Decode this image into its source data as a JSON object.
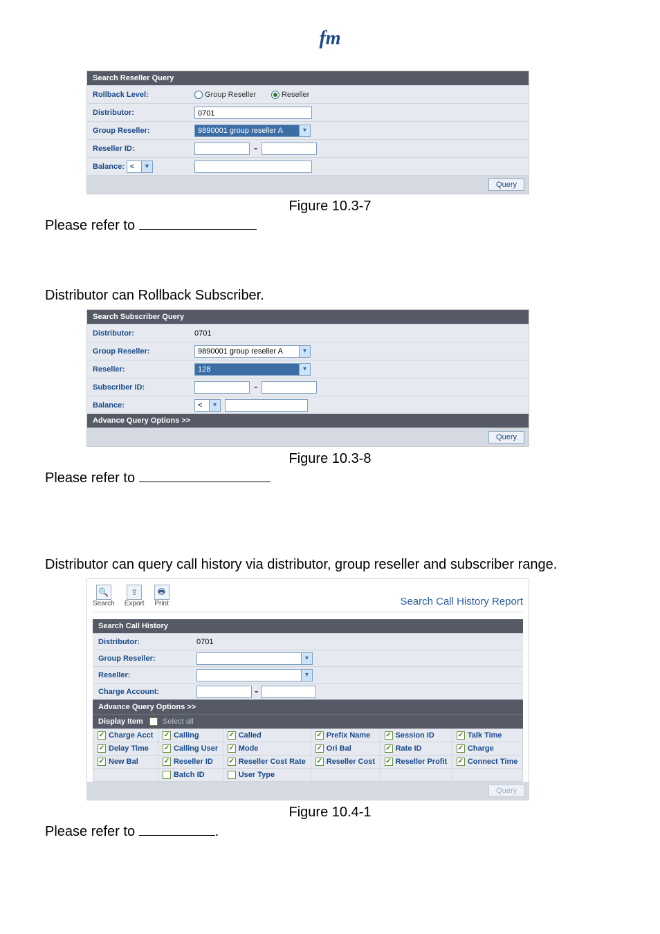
{
  "logo": "fm",
  "panel1": {
    "header": "Search Reseller Query",
    "rows": {
      "rollback_label": "Rollback Level:",
      "radio_group": "Group Reseller",
      "radio_reseller": "Reseller",
      "distributor_label": "Distributor:",
      "distributor_value": "0701",
      "group_reseller_label": "Group Reseller:",
      "group_reseller_value": "9890001 group reseller A",
      "reseller_id_label": "Reseller ID:",
      "reseller_id_sep": "-",
      "balance_label": "Balance:",
      "balance_op": "<"
    },
    "query_btn": "Query",
    "caption": "Figure 10.3-7"
  },
  "refer1": "Please refer to ",
  "section2_intro": "Distributor can Rollback Subscriber.",
  "panel2": {
    "header": "Search Subscriber Query",
    "rows": {
      "distributor_label": "Distributor:",
      "distributor_value": "0701",
      "group_reseller_label": "Group Reseller:",
      "group_reseller_value": "9890001 group reseller A",
      "reseller_label": "Reseller:",
      "reseller_value": "128",
      "subscriber_id_label": "Subscriber ID:",
      "subscriber_id_sep": "-",
      "balance_label": "Balance:",
      "balance_op": "<"
    },
    "adv": "Advance Query Options >>",
    "query_btn": "Query",
    "caption": "Figure 10.3-8"
  },
  "refer2": "Please refer to ",
  "section3_intro": "Distributor can query call history via distributor, group reseller and subscriber range.",
  "report": {
    "toolbar": {
      "search": "Search",
      "export": "Export",
      "print": "Print"
    },
    "title": "Search Call History Report",
    "header": "Search Call History",
    "rows": {
      "distributor_label": "Distributor:",
      "distributor_value": "0701",
      "group_reseller_label": "Group Reseller:",
      "reseller_label": "Reseller:",
      "charge_account_label": "Charge Account:",
      "charge_account_sep": "-"
    },
    "adv": "Advance Query Options >>",
    "display_item": "Display Item",
    "select_all": "Select all",
    "cols": {
      "charge_acct": "Charge Acct",
      "calling": "Calling",
      "called": "Called",
      "prefix_name": "Prefix Name",
      "session_id": "Session ID",
      "talk_time": "Talk Time",
      "delay_time": "Delay Time",
      "calling_user": "Calling User",
      "mode": "Mode",
      "ori_bal": "Ori Bal",
      "rate_id": "Rate ID",
      "charge": "Charge",
      "new_bal": "New Bal",
      "reseller_id": "Reseller ID",
      "reseller_cost_rate": "Reseller Cost Rate",
      "reseller_cost": "Reseller Cost",
      "reseller_profit": "Reseller Profit",
      "connect_time": "Connect Time",
      "batch_id": "Batch ID",
      "user_type": "User Type"
    },
    "query_btn": "Query",
    "caption": "Figure 10.4-1"
  },
  "refer3_a": "Please refer to ",
  "refer3_b": "."
}
